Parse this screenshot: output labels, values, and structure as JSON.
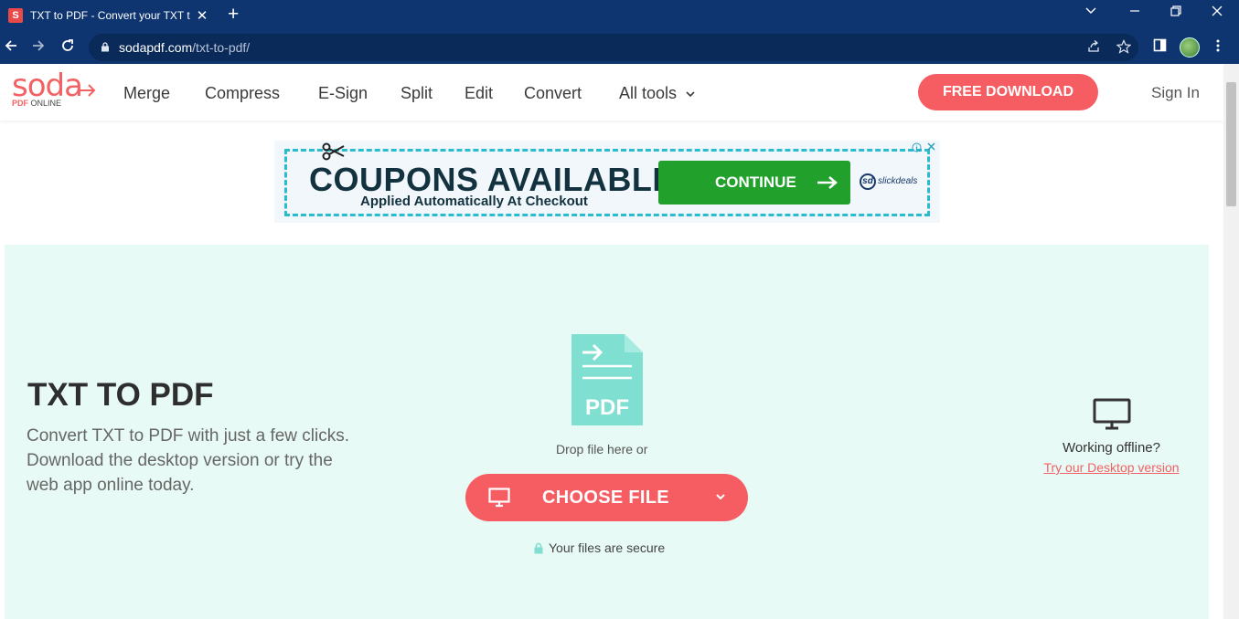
{
  "browser": {
    "tab_title": "TXT to PDF - Convert your TXT to PDF",
    "tab_favicon": "S",
    "tab_close": "✕",
    "new_tab": "+",
    "url_domain": "sodapdf.com",
    "url_path": "/txt-to-pdf/"
  },
  "header": {
    "logo_word": "soda",
    "logo_sub_bold": "PDF",
    "logo_sub": " ONLINE",
    "nav": [
      "Merge",
      "Compress",
      "E-Sign",
      "Split",
      "Edit",
      "Convert",
      "All tools"
    ],
    "free_download": "FREE DOWNLOAD",
    "sign_in": "Sign In"
  },
  "ad": {
    "title": "COUPONS AVAILABLE",
    "subtitle": "Applied Automatically At Checkout",
    "button": "CONTINUE",
    "brand": "slickdeals"
  },
  "hero": {
    "title": "TXT TO PDF",
    "description": "Convert TXT to PDF with just a few clicks. Download the desktop version or try the web app online today.",
    "pdf_label": "PDF",
    "drop_text": "Drop file here or",
    "choose_file": "CHOOSE FILE",
    "secure": "Your files are secure"
  },
  "offline": {
    "title": "Working offline?",
    "link": "Try our Desktop version"
  },
  "colors": {
    "brand": "#f26163",
    "button": "#f65d62",
    "hero_bg": "#e8faf5",
    "pdf_icon": "#7fdfd0",
    "browser": "#0e3570",
    "ad_green": "#21a02c"
  }
}
